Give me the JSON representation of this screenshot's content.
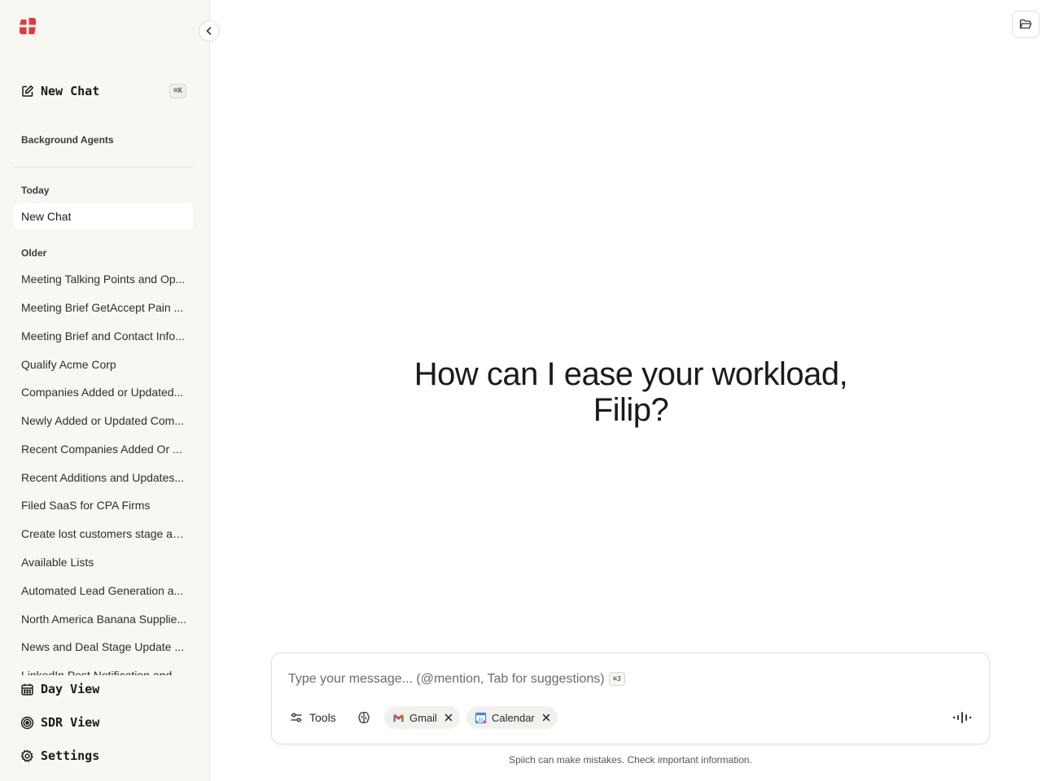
{
  "app": {
    "brand_color": "#e0393e"
  },
  "sidebar": {
    "new_chat_label": "New Chat",
    "new_chat_shortcut": "⌘K",
    "background_agents_label": "Background Agents",
    "today_label": "Today",
    "today_items": [
      {
        "label": "New Chat"
      }
    ],
    "older_label": "Older",
    "older_items": [
      {
        "label": "Meeting Talking Points and Op..."
      },
      {
        "label": "Meeting Brief GetAccept Pain ..."
      },
      {
        "label": "Meeting Brief and Contact Info..."
      },
      {
        "label": "Qualify Acme Corp"
      },
      {
        "label": "Companies Added or Updated..."
      },
      {
        "label": "Newly Added or Updated Com..."
      },
      {
        "label": "Recent Companies Added Or ..."
      },
      {
        "label": "Recent Additions and Updates..."
      },
      {
        "label": "Filed SaaS for CPA Firms"
      },
      {
        "label": "Create lost customers stage an..."
      },
      {
        "label": "Available Lists"
      },
      {
        "label": "Automated Lead Generation a..."
      },
      {
        "label": "North America Banana Supplie..."
      },
      {
        "label": "News and Deal Stage Update ..."
      },
      {
        "label": "LinkedIn Post Notification and..."
      }
    ],
    "bottom_nav": {
      "day_view": "Day View",
      "sdr_view": "SDR View",
      "settings": "Settings"
    }
  },
  "main": {
    "greeting_line1": "How can I ease your workload,",
    "greeting_line2": "Filip?",
    "composer": {
      "placeholder": "Type your message... (@mention, Tab for suggestions)",
      "shortcut": "⌘J",
      "tools_label": "Tools",
      "chips": [
        {
          "label": "Gmail",
          "icon": "gmail-icon"
        },
        {
          "label": "Calendar",
          "icon": "google-calendar-icon"
        }
      ]
    },
    "disclaimer": "Spiich can make mistakes. Check important information."
  }
}
